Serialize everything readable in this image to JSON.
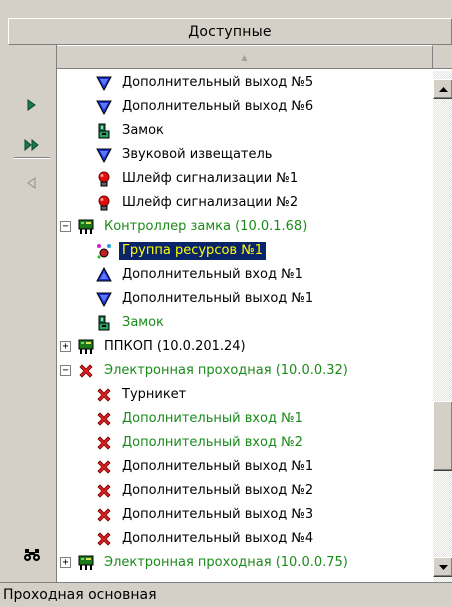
{
  "header": {
    "title": "Доступные"
  },
  "status": {
    "text": "Проходная основная"
  },
  "colors": {
    "green": "#1a8a1a",
    "selection": "#0a246a",
    "selection_text": "#ffff00"
  },
  "toolbar": {
    "buttons": [
      {
        "icon": "arrow-right-icon"
      },
      {
        "icon": "double-arrow-right-icon"
      },
      {
        "icon": "arrow-left-icon"
      },
      {
        "icon": "binoculars-icon"
      }
    ]
  },
  "tree": {
    "rows": [
      {
        "label": "Дополнительный выход №5",
        "icon": "output-icon"
      },
      {
        "label": "Дополнительный выход №6",
        "icon": "output-icon"
      },
      {
        "label": "Замок",
        "icon": "lock-icon"
      },
      {
        "label": "Звуковой извещатель",
        "icon": "output-icon"
      },
      {
        "label": "Шлейф сигнализации №1",
        "icon": "alarm-loop-icon"
      },
      {
        "label": "Шлейф сигнализации №2",
        "icon": "alarm-loop-icon"
      },
      {
        "label": "Контроллер замка (10.0.1.68)",
        "icon": "controller-icon",
        "expander": "−",
        "color": "green"
      },
      {
        "label": "Группа ресурсов №1",
        "icon": "resource-group-icon",
        "selected": true
      },
      {
        "label": "Дополнительный вход №1",
        "icon": "input-icon"
      },
      {
        "label": "Дополнительный выход №1",
        "icon": "output-icon"
      },
      {
        "label": "Замок",
        "icon": "lock-icon",
        "color": "green"
      },
      {
        "label": "ППКОП (10.0.201.24)",
        "icon": "controller-icon",
        "expander": "+"
      },
      {
        "label": "Электронная проходная (10.0.0.32)",
        "icon": "error-icon",
        "expander": "−",
        "color": "green"
      },
      {
        "label": "Турникет",
        "icon": "error-icon"
      },
      {
        "label": "Дополнительный вход №1",
        "icon": "error-icon",
        "color": "green"
      },
      {
        "label": "Дополнительный вход №2",
        "icon": "error-icon",
        "color": "green"
      },
      {
        "label": "Дополнительный выход №1",
        "icon": "error-icon"
      },
      {
        "label": "Дополнительный выход №2",
        "icon": "error-icon"
      },
      {
        "label": "Дополнительный выход №3",
        "icon": "error-icon"
      },
      {
        "label": "Дополнительный выход №4",
        "icon": "error-icon"
      },
      {
        "label": "Электронная проходная (10.0.0.75)",
        "icon": "controller-icon",
        "expander": "+",
        "color": "green"
      }
    ]
  }
}
